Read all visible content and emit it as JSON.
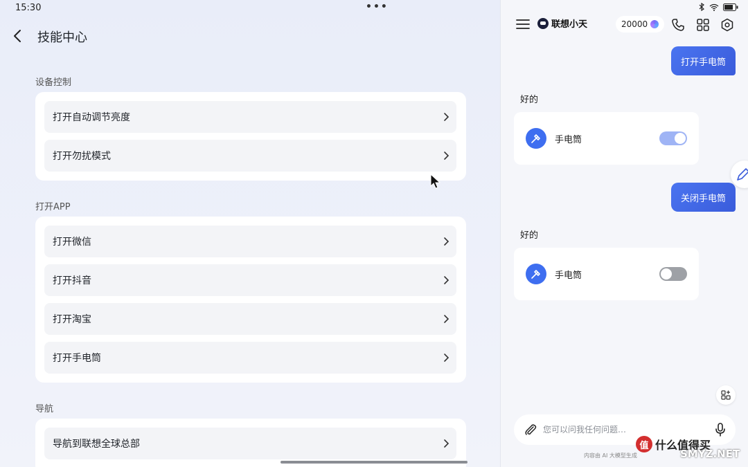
{
  "status": {
    "time": "15:30",
    "more": "•••"
  },
  "left": {
    "title": "技能中心",
    "sections": [
      {
        "label": "设备控制",
        "items": [
          "打开自动调节亮度",
          "打开勿扰模式"
        ]
      },
      {
        "label": "打开APP",
        "items": [
          "打开微信",
          "打开抖音",
          "打开淘宝",
          "打开手电筒"
        ]
      },
      {
        "label": "导航",
        "items": [
          "导航到联想全球总部"
        ]
      }
    ]
  },
  "right": {
    "brand": "联想小天",
    "points": "20000",
    "messages": [
      {
        "user": "打开手电筒",
        "reply": "好的",
        "skill": "手电筒",
        "state": "on"
      },
      {
        "user": "关闭手电筒",
        "reply": "好的",
        "skill": "手电筒",
        "state": "off"
      }
    ],
    "input_placeholder": "您可以问我任何问题…",
    "disclaimer": "内容由 AI 大模型生成"
  },
  "watermark": {
    "logo": "值",
    "text": "什么值得买",
    "site": "SMYZ.NET"
  },
  "colors": {
    "accent": "#3e6ef0",
    "toggle_on": "#9fb4f5",
    "toggle_off": "#9ea1a6"
  }
}
